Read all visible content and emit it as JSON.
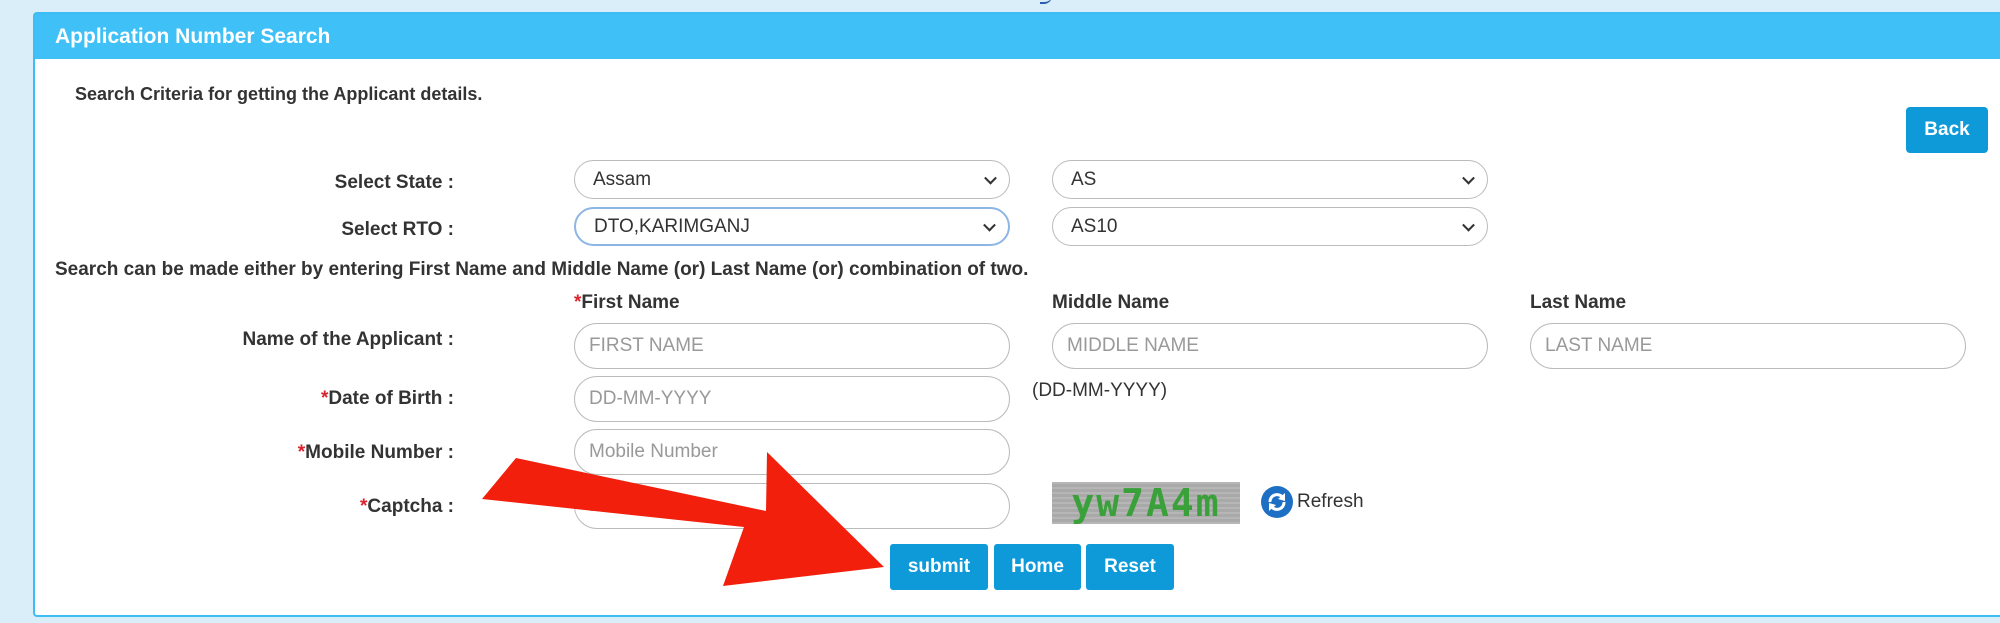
{
  "panel": {
    "title": "Application Number Search",
    "criteria": "Search Criteria for getting the Applicant details.",
    "back_label": "Back"
  },
  "state": {
    "label": "Select State :",
    "state_value": "Assam",
    "code_value": "AS"
  },
  "rto": {
    "label": "Select RTO :",
    "rto_value": "DTO,KARIMGANJ",
    "code_value": "AS10"
  },
  "info": "Search can be made either by entering First Name and Middle Name (or) Last Name (or) combination of two.",
  "name": {
    "label": "Name of the Applicant :",
    "first_head": "First Name",
    "middle_head": "Middle Name",
    "last_head": "Last Name",
    "first_placeholder": "FIRST NAME",
    "middle_placeholder": "MIDDLE NAME",
    "last_placeholder": "LAST NAME"
  },
  "dob": {
    "label": "Date of Birth :",
    "placeholder": "DD-MM-YYYY",
    "hint": "(DD-MM-YYYY)"
  },
  "mobile": {
    "label": "Mobile Number :",
    "placeholder": "Mobile Number"
  },
  "captcha": {
    "label": "Captcha :",
    "placeholder": "Enter Captcha",
    "image_text": "yw7A4m",
    "refresh_label": "Refresh"
  },
  "required_mark": "*",
  "buttons": {
    "submit": "submit",
    "home": "Home",
    "reset": "Reset"
  },
  "annotation": {
    "arrow_color": "#f21f0c"
  }
}
